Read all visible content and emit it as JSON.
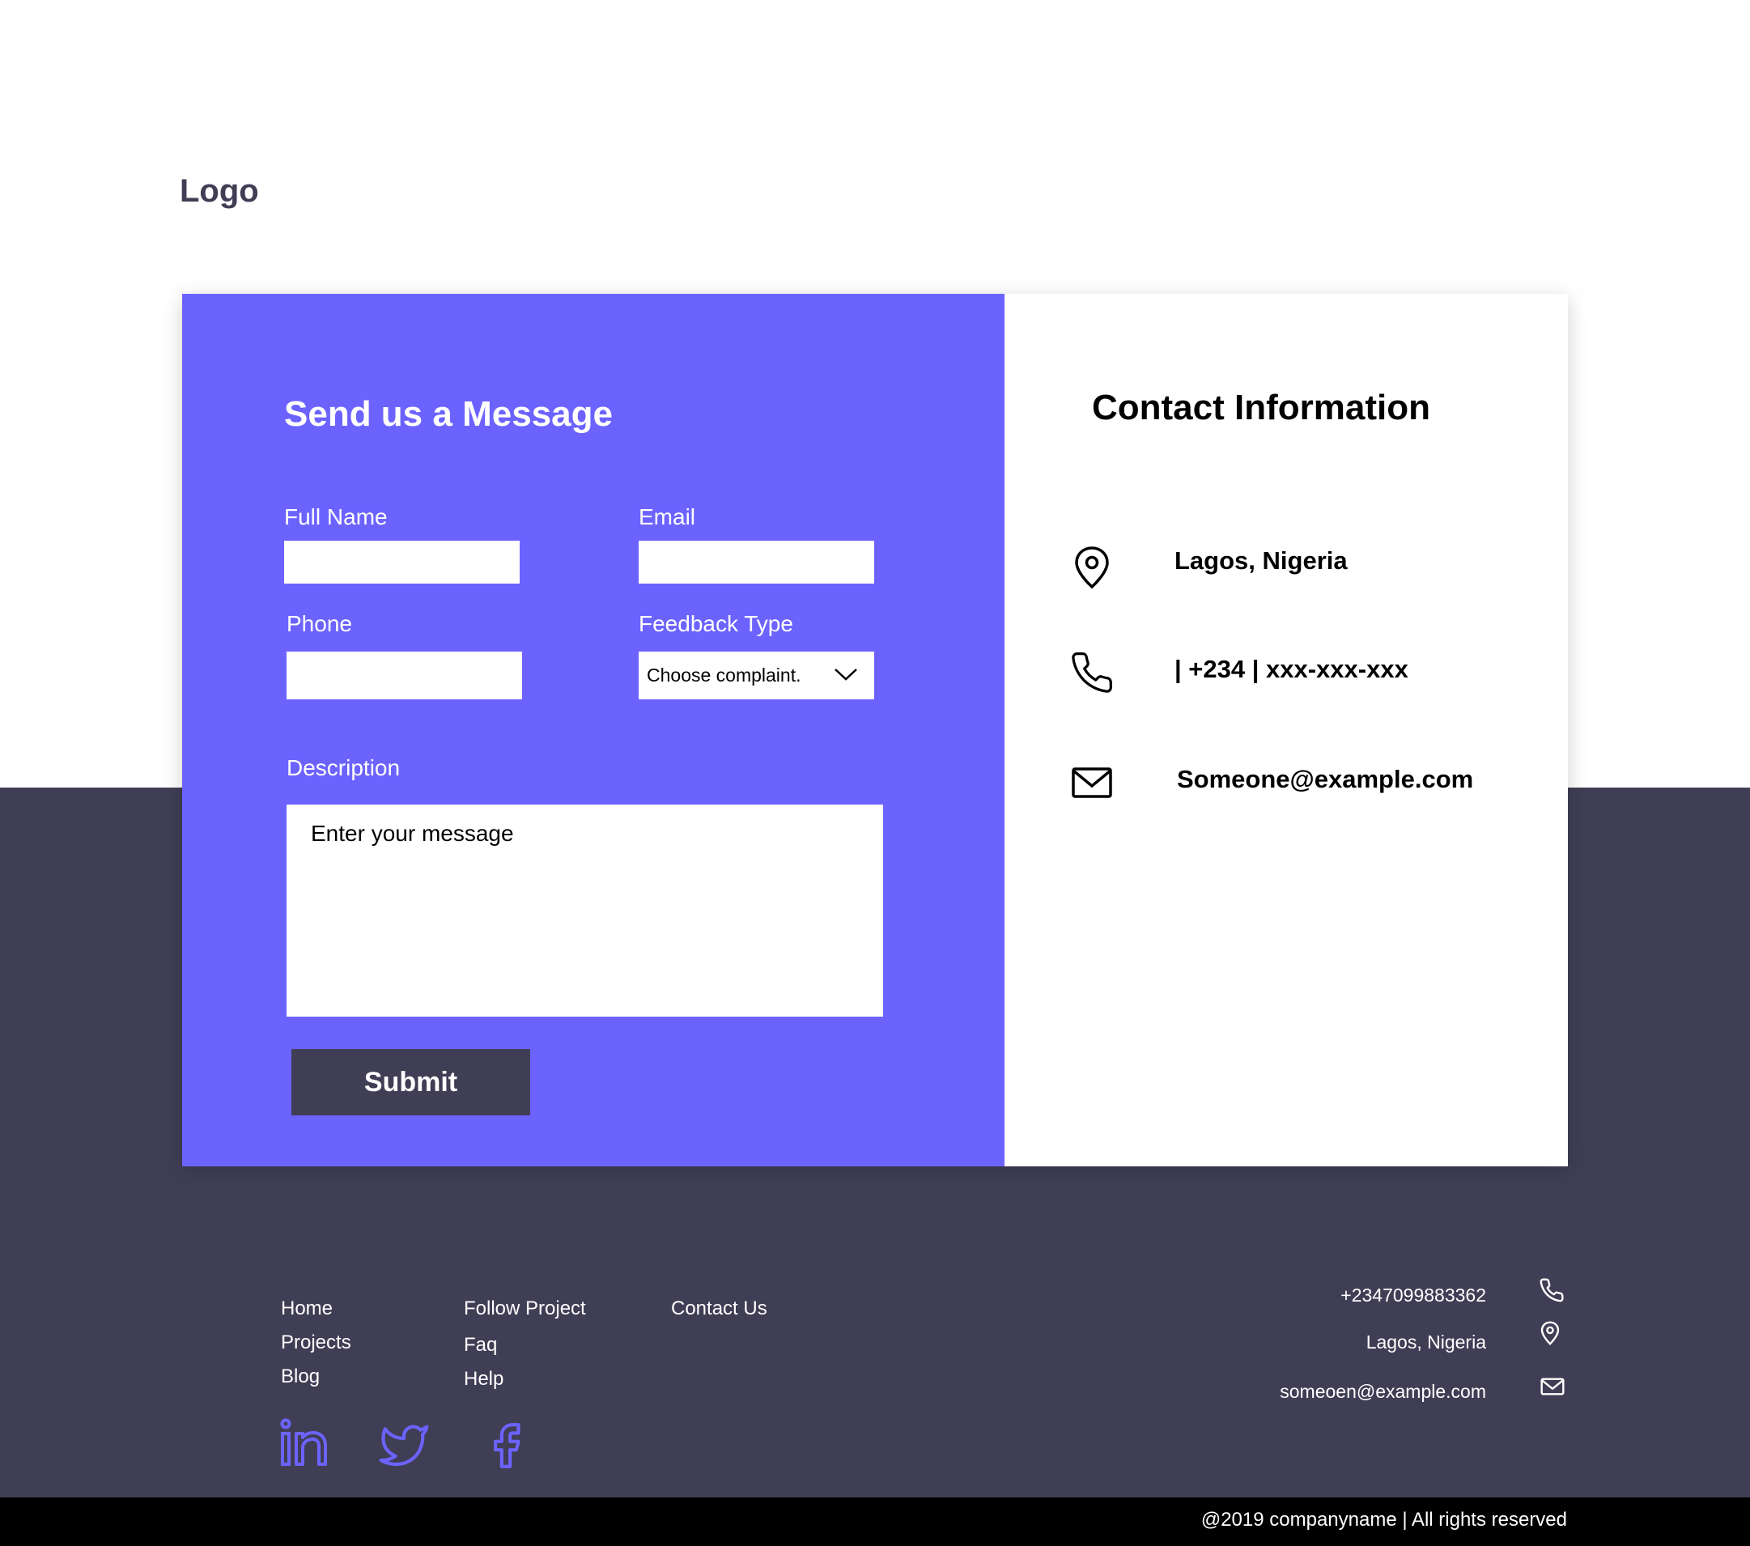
{
  "header": {
    "logo": "Logo"
  },
  "form": {
    "title": "Send us a Message",
    "full_name_label": "Full Name",
    "full_name_value": "",
    "email_label": "Email",
    "email_value": "",
    "phone_label": "Phone",
    "phone_value": "",
    "feedback_label": "Feedback Type",
    "feedback_selected": "Choose complaint.",
    "description_label": "Description",
    "description_placeholder": "Enter your message",
    "submit_label": "Submit"
  },
  "contact_info": {
    "title": "Contact Information",
    "location": "Lagos, Nigeria",
    "phone": "| +234 | xxx-xxx-xxx",
    "email": "Someone@example.com"
  },
  "footer": {
    "links_col1": [
      "Home",
      "Projects",
      "Blog"
    ],
    "links_col2": [
      "Follow Project",
      "Faq",
      "Help"
    ],
    "links_col3": [
      "Contact Us"
    ],
    "contact": {
      "phone": "+2347099883362",
      "location": "Lagos, Nigeria",
      "email": "someoen@example.com"
    },
    "social": [
      "linkedin-icon",
      "twitter-icon",
      "facebook-icon"
    ],
    "copyright": "@2019 companyname | All rights reserved"
  },
  "colors": {
    "accent": "#6c63ff",
    "dark": "#403e55",
    "black": "#000000",
    "white": "#ffffff"
  }
}
